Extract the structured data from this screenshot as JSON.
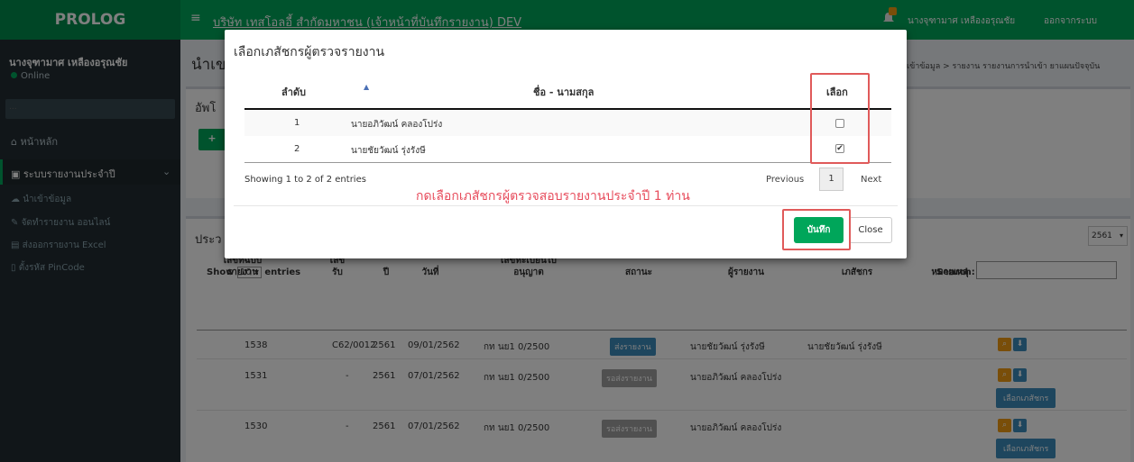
{
  "header": {
    "logo": "PROLOG",
    "menu_icon": "≡",
    "company": "บริษัท เทสโอลอี้ สำกัดมหาชน (เจ้าหน้าที่บันทึกรายงาน) DEV",
    "user": "นางจุฑามาศ เหลืองอรุณชัย",
    "logout": "ออกจากระบบ"
  },
  "sidebar": {
    "user_name": "นางจุฑามาศ เหลืองอรุณชัย",
    "status": "Online",
    "search_placeholder": "...",
    "home": "หน้าหลัก",
    "annual_report": "ระบบรายงานประจำปี",
    "sub_items": [
      "นำเข้าข้อมูล",
      "จัดทำรายงาน ออนไลน์",
      "ส่งออกรายงาน Excel",
      "ตั้งรหัส PinCode"
    ]
  },
  "content": {
    "page_title": "นำเข",
    "breadcrumb": "เข้าข้อมูล  >  รายงาน รายงานการนำเข้า ยาแผนปัจจุบัน",
    "upload_title": "อัพโ",
    "upload_btn": "+",
    "list_title": "ประว",
    "year": "2561",
    "show_label": "Show",
    "show_value": "10",
    "entries_label": "entries",
    "search_label": "Search:",
    "columns": [
      "เลขที่ฉบับ รายงาน",
      "เลข รับ",
      "ปี",
      "วันที่",
      "เลขทะเบียนใบ อนุญาต",
      "สถานะ",
      "ผู้รายงาน",
      "เภสัชกร",
      "หมายเหตุ"
    ],
    "rows": [
      {
        "no": "1538",
        "recv": "C62/0012",
        "year": "2561",
        "date": "09/01/2562",
        "license": "กท นย1 0/2500",
        "status": "ส่งรายงาน",
        "reporter": "นายชัยวัฒน์ รุ่งรังษี",
        "pharmacist": "นายชัยวัฒน์ รุ่งรังษี"
      },
      {
        "no": "1531",
        "recv": "-",
        "year": "2561",
        "date": "07/01/2562",
        "license": "กท นย1 0/2500",
        "status": "รอส่งรายงาน",
        "reporter": "นายอภิวัฒน์ คลองโปร่ง",
        "pharmacist": ""
      },
      {
        "no": "1530",
        "recv": "-",
        "year": "2561",
        "date": "07/01/2562",
        "license": "กท นย1 0/2500",
        "status": "รอส่งรายงาน",
        "reporter": "นายอภิวัฒน์ คลองโปร่ง",
        "pharmacist": ""
      }
    ],
    "choose_pharmacist": "เลือกเภสัชกร"
  },
  "modal": {
    "title": "เลือกเภสัชกรผู้ตรวจรายงาน",
    "col_no": "ลำดับ",
    "col_name": "ชื่อ - นามสกุล",
    "col_select": "เลือก",
    "rows": [
      {
        "no": "1",
        "name": "นายอภิวัฒน์ คลองโปร่ง",
        "checked": false
      },
      {
        "no": "2",
        "name": "นายชัยวัฒน์ รุ่งรังษี",
        "checked": true
      }
    ],
    "info": "Showing 1 to 2 of 2 entries",
    "prev": "Previous",
    "page": "1",
    "next": "Next",
    "note": "กดเลือกเภสัชกรผู้ตรวจสอบรายงานประจำปี 1 ท่าน",
    "save": "บันทึก",
    "close": "Close"
  }
}
